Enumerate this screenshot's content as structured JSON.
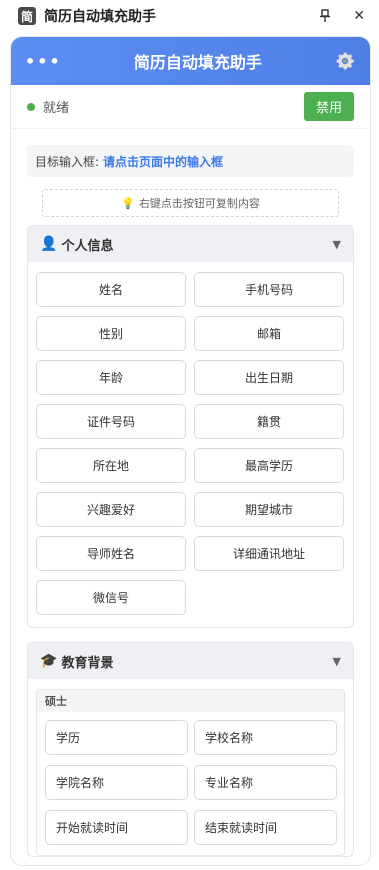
{
  "window": {
    "icon_char": "简",
    "title": "简历自动填充助手",
    "pin_icon": "pin-icon",
    "close_glyph": "✕"
  },
  "header": {
    "menu_glyph": "•••",
    "title": "简历自动填充助手",
    "settings_icon": "gear-icon"
  },
  "status": {
    "text": "就绪",
    "toggle_label": "禁用",
    "dot_color": "#4caf50"
  },
  "target": {
    "label": "目标输入框:",
    "value": "请点击页面中的输入框"
  },
  "hint": {
    "icon": "💡",
    "text": "右键点击按钮可复制内容"
  },
  "personal": {
    "icon": "👤",
    "title": "个人信息",
    "caret": "▼",
    "fields": [
      "姓名",
      "手机号码",
      "性别",
      "邮箱",
      "年龄",
      "出生日期",
      "证件号码",
      "籍贯",
      "所在地",
      "最高学历",
      "兴趣爱好",
      "期望城市",
      "导师姓名",
      "详细通讯地址",
      "微信号"
    ]
  },
  "education": {
    "icon": "🎓",
    "title": "教育背景",
    "caret": "▼",
    "group_title": "硕士",
    "fields": [
      "学历",
      "学校名称",
      "学院名称",
      "专业名称",
      "开始就读时间",
      "结束就读时间"
    ]
  },
  "colors": {
    "accent": "#4f7fe6",
    "status_green": "#4caf50",
    "link_blue": "#3b7be8"
  }
}
